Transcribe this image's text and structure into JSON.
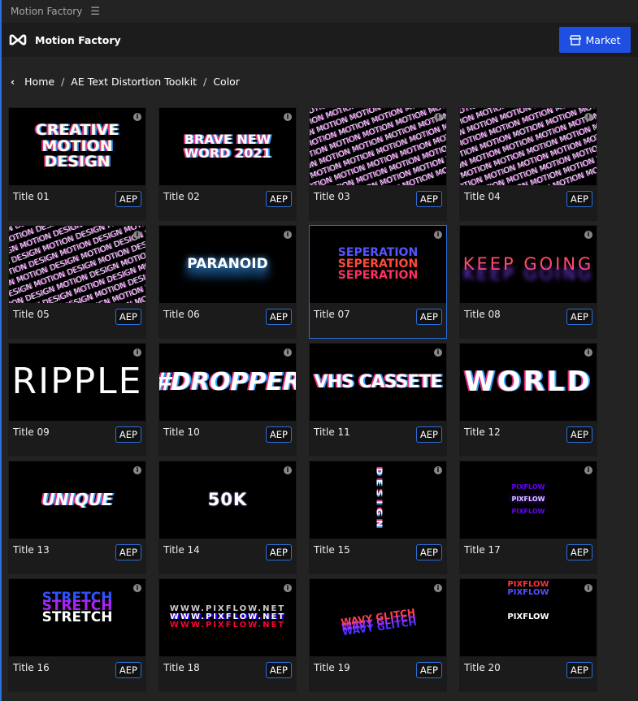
{
  "window": {
    "title": "Motion Factory",
    "menu_icon": "hamburger-icon"
  },
  "header": {
    "brand": "Motion Factory",
    "logo_icon": "motion-factory-logo",
    "market_label": "Market",
    "market_icon": "store-icon",
    "accent": "#1f4fe0"
  },
  "breadcrumb": {
    "back_icon": "chevron-left-icon",
    "items": [
      "Home",
      "AE Text Distortion Toolkit",
      "Color"
    ]
  },
  "cards": [
    {
      "title": "Title 01",
      "badge": "AEP",
      "art": "CREATIVE MOTION DESIGN"
    },
    {
      "title": "Title 02",
      "badge": "AEP",
      "art": "BRAVE NEW WORD 2021"
    },
    {
      "title": "Title 03",
      "badge": "AEP",
      "art": "MOTION"
    },
    {
      "title": "Title 04",
      "badge": "AEP",
      "art": "MOTION"
    },
    {
      "title": "Title 05",
      "badge": "AEP",
      "art": "MOTION DESIGN"
    },
    {
      "title": "Title 06",
      "badge": "AEP",
      "art": "PARANOID"
    },
    {
      "title": "Title 07",
      "badge": "AEP",
      "art": "SEPERATION",
      "selected": true
    },
    {
      "title": "Title 08",
      "badge": "AEP",
      "art": "KEEP GOING"
    },
    {
      "title": "Title 09",
      "badge": "AEP",
      "art": "RIPPLE"
    },
    {
      "title": "Title 10",
      "badge": "AEP",
      "art": "#DROPPER"
    },
    {
      "title": "Title 11",
      "badge": "AEP",
      "art": "VHS CASSETE"
    },
    {
      "title": "Title 12",
      "badge": "AEP",
      "art": "WORLD"
    },
    {
      "title": "Title 13",
      "badge": "AEP",
      "art": "UNIQUE"
    },
    {
      "title": "Title 14",
      "badge": "AEP",
      "art": "50K"
    },
    {
      "title": "Title 15",
      "badge": "AEP",
      "art": "DESIGN"
    },
    {
      "title": "Title 17",
      "badge": "AEP",
      "art": "PIXFLOW"
    },
    {
      "title": "Title 16",
      "badge": "AEP",
      "art": "STRETCH"
    },
    {
      "title": "Title 18",
      "badge": "AEP",
      "art": "WWW.PIXFLOW.NET"
    },
    {
      "title": "Title 19",
      "badge": "AEP",
      "art": "WAVY GLITCH"
    },
    {
      "title": "Title 20",
      "badge": "AEP",
      "art": "PIXFLOW"
    }
  ]
}
